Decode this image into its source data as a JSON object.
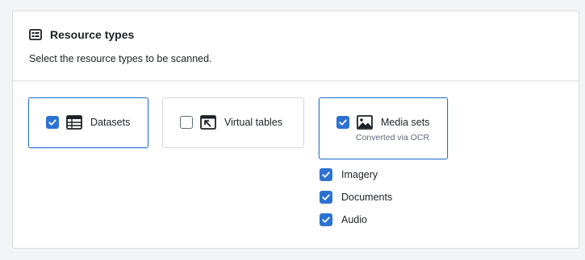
{
  "section": {
    "title": "Resource types",
    "description": "Select the resource types to be scanned."
  },
  "resource_cards": [
    {
      "label": "Datasets",
      "checked": true,
      "icon": "table-icon"
    },
    {
      "label": "Virtual tables",
      "checked": false,
      "icon": "virtual-table-icon"
    },
    {
      "label": "Media sets",
      "sublabel": "Converted via OCR",
      "checked": true,
      "icon": "media-image-icon"
    }
  ],
  "media_options": [
    {
      "label": "Imagery",
      "checked": true
    },
    {
      "label": "Documents",
      "checked": true
    },
    {
      "label": "Audio",
      "checked": true
    }
  ],
  "colors": {
    "accent": "#2d72d2",
    "border": "#d3d8de",
    "text": "#1c2127",
    "muted": "#5f6b7c"
  }
}
